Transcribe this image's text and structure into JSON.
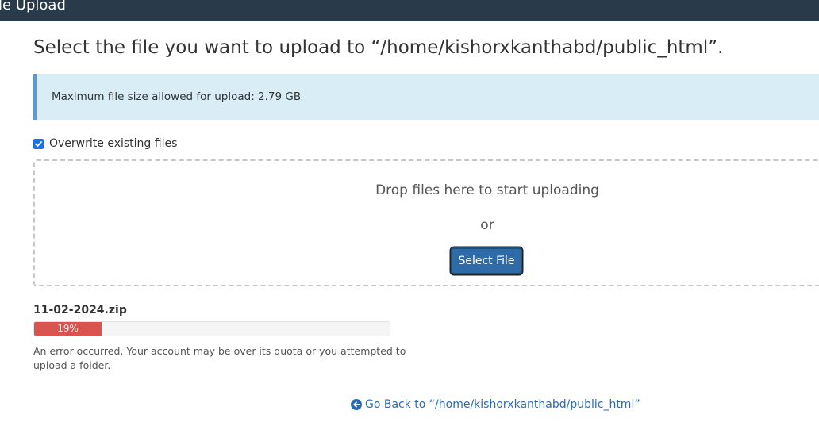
{
  "header": {
    "title": "ile Upload"
  },
  "heading": "Select the file you want to upload to “/home/kishorxkanthabd/public_html”.",
  "alert": {
    "text": "Maximum file size allowed for upload: 2.79 GB"
  },
  "overwrite": {
    "label": "Overwrite existing files",
    "checked": true
  },
  "dropzone": {
    "text": "Drop files here to start uploading",
    "or_text": "or",
    "button_label": "Select File"
  },
  "upload": {
    "filename": "11-02-2024.zip",
    "progress_percent": 19,
    "progress_label": "19%",
    "error": "An error occurred. Your account may be over its quota or you attempted to upload a folder."
  },
  "back_link": {
    "label": "Go Back to “/home/kishorxkanthabd/public_html”",
    "icon": "circle-arrow-left-icon"
  },
  "colors": {
    "topbar": "#293a4a",
    "alert_bg": "#d9edf7",
    "alert_border": "#5b9bd1",
    "button": "#2f6ba6",
    "progress_error": "#d9534f",
    "link": "#2a6bb3"
  }
}
